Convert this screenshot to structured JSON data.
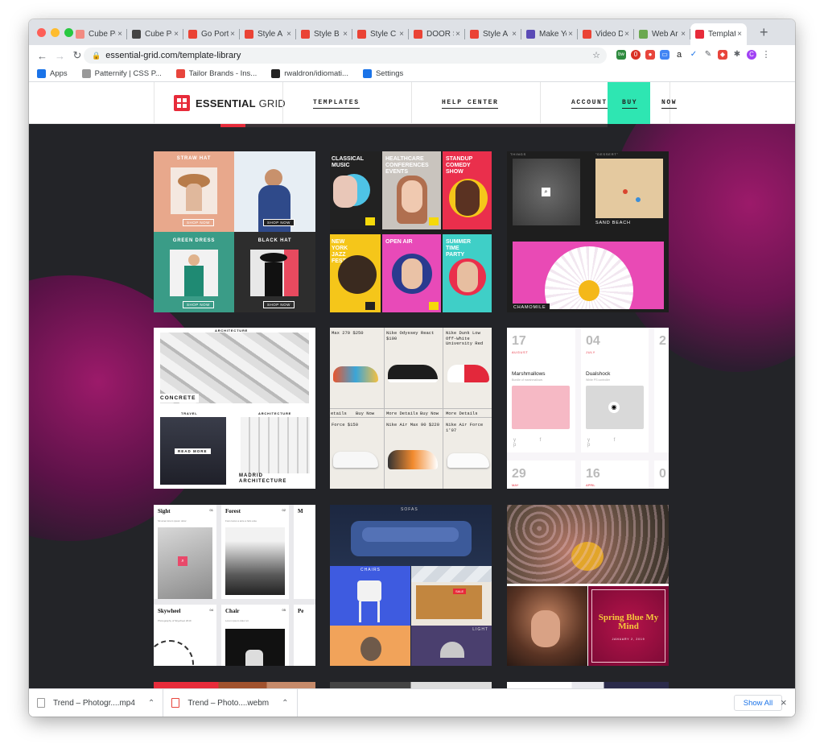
{
  "browser": {
    "tabs": [
      {
        "title": "Cube Po",
        "color": "#f28b82"
      },
      {
        "title": "Cube Po",
        "color": "#444444"
      },
      {
        "title": "Go Portf",
        "color": "#ea4335"
      },
      {
        "title": "Style A",
        "color": "#ea4335"
      },
      {
        "title": "Style B",
        "color": "#ea4335"
      },
      {
        "title": "Style C",
        "color": "#ea4335"
      },
      {
        "title": "DOOR S",
        "color": "#ea4335"
      },
      {
        "title": "Style A",
        "color": "#ea4335"
      },
      {
        "title": "Make Yo",
        "color": "#5b4bb6"
      },
      {
        "title": "Video D",
        "color": "#ea4335"
      },
      {
        "title": "Web Ar",
        "color": "#6aa84f"
      },
      {
        "title": "Templat",
        "color": "#e72b3a",
        "active": true
      }
    ],
    "new_tab": "+",
    "url": "essential-grid.com/template-library",
    "bookmarks": [
      {
        "label": "Apps",
        "icon": "apps-grid-icon",
        "color": "#1a73e8"
      },
      {
        "label": "Patternify | CSS P...",
        "icon": "pattern-icon",
        "color": "#999999"
      },
      {
        "label": "Tailor Brands - Ins...",
        "icon": "tailor-brands-icon",
        "color": "#e8453c"
      },
      {
        "label": "rwaldron/idiomati...",
        "icon": "github-icon",
        "color": "#222222"
      },
      {
        "label": "Settings",
        "icon": "gear-icon",
        "color": "#1a73e8"
      }
    ],
    "extensions": [
      "bw",
      "0",
      "shield",
      "ext",
      "a",
      "check",
      "dropper",
      "puzzle",
      "C"
    ]
  },
  "site": {
    "logo_bold": "ESSENTIAL",
    "logo_light": "GRID",
    "nav": {
      "templates": "TEMPLATES",
      "help": "HELP CENTER",
      "account": "ACCOUNT",
      "buy": "BUY",
      "now": "NOW"
    },
    "accent": "#2ee6b2",
    "brand": "#e72b3a"
  },
  "cards": {
    "fashion": {
      "straw": "STRAW HAT",
      "green": "GREEN DRESS",
      "black": "BLACK HAT",
      "shop": "SHOP NOW"
    },
    "events": {
      "classical": "CLASSICAL MUSIC",
      "healthcare": "HEALTHCARE CONFERENCES EVENTS",
      "standup": "STANDUP COMEDY SHOW",
      "jazz": "NEW YORK JAZZ FESTIVAL",
      "openair": "OPEN AIR",
      "summer": "SUMMER TIME PARTY"
    },
    "photo": {
      "beach": "SAND BEACH",
      "flower": "CHAMOMILE",
      "top_left": "THINGS",
      "top_right": "\"DESSERT\""
    },
    "architecture": {
      "top": "ARCHITECTURE",
      "concrete": "CONCRETE",
      "travel": "TRAVEL",
      "arch2": "ARCHITECTURE",
      "read": "READ MORE",
      "madrid1": "MADRID",
      "madrid2": "ARCHITECTURE"
    },
    "sneakers": {
      "r1": [
        "Max 270      $250",
        "Nike Odyssey React   $100",
        "Nike Dunk Low Off-White University Red"
      ],
      "r2": [
        "Force        $150",
        "Nike Air Max 90      $220",
        "Nike Air Force 1'07"
      ],
      "buttons": [
        "etails",
        "Buy Now",
        "More Details",
        "Buy Now",
        "More Details"
      ]
    },
    "calendar": {
      "d1": "17",
      "m1": "AUGUST",
      "d2": "04",
      "m2": "JULY",
      "t1": "Marshmallows",
      "s1": "Bundle of marshmallows",
      "t2": "Dualshock",
      "s2": "White PS controller",
      "d3": "29",
      "m3": "MAY",
      "d4": "16",
      "m4": "APRIL"
    },
    "blog": {
      "a": "Sight",
      "an": "01",
      "b": "Forest",
      "bn": "02",
      "c": "M",
      "d": "Skywheel",
      "dn": "04",
      "e": "Chair",
      "en": "05",
      "f": "Pe",
      "desc_a": "Sit amet lorem ipsum dolor",
      "desc_b": "Fons lacus a ante a felis ante",
      "desc_d": "Photography of Skywheel 2019",
      "desc_e": "Lorem ipsum dolor sit"
    },
    "furniture": {
      "sofas": "SOFAS",
      "chairs": "CHAIRS",
      "light": "LIGHT",
      "sale": "SALE"
    },
    "spring": {
      "title": "Spring Blue My Mind",
      "date": "JANUARY 2, 2019"
    }
  },
  "downloads": {
    "items": [
      "Trend – Photogr....mp4",
      "Trend – Photo....webm"
    ],
    "show_all": "Show All",
    "close": "×"
  }
}
